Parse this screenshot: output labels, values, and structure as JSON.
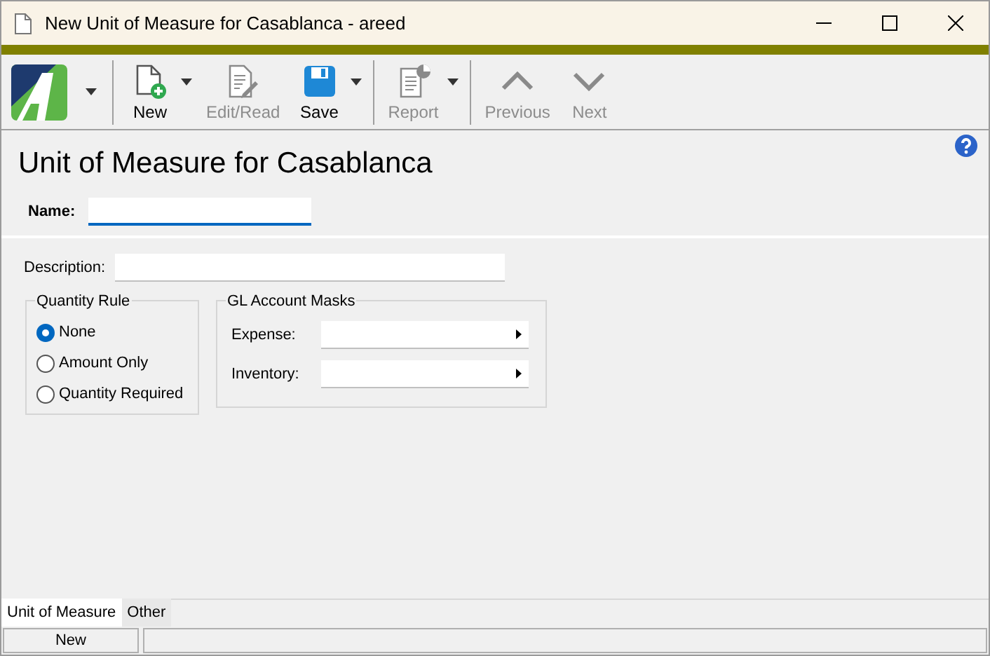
{
  "window": {
    "title": "New Unit of Measure for Casablanca - areed"
  },
  "toolbar": [
    {
      "kind": "logo",
      "dropdown": true
    },
    {
      "kind": "new",
      "label": "New",
      "disabled": false,
      "dropdown": true
    },
    {
      "kind": "edit",
      "label": "Edit/Read",
      "disabled": true,
      "dropdown": false
    },
    {
      "kind": "save",
      "label": "Save",
      "disabled": false,
      "dropdown": true
    },
    {
      "kind": "report",
      "label": "Report",
      "disabled": true,
      "dropdown": true
    },
    {
      "kind": "previous",
      "label": "Previous",
      "disabled": true,
      "dropdown": false
    },
    {
      "kind": "next",
      "label": "Next",
      "disabled": true,
      "dropdown": false
    }
  ],
  "heading": "Unit of Measure for Casablanca",
  "name_field": {
    "label": "Name:"
  },
  "description_field": {
    "label": "Description:"
  },
  "quantity_rule": {
    "title": "Quantity Rule",
    "options": [
      {
        "label": "None",
        "selected": true
      },
      {
        "label": "Amount Only",
        "selected": false
      },
      {
        "label": "Quantity Required",
        "selected": false
      }
    ]
  },
  "gl_account_masks": {
    "title": "GL Account Masks",
    "fields": [
      {
        "label": "Expense:"
      },
      {
        "label": "Inventory:"
      }
    ]
  },
  "tabs": [
    {
      "label": "Unit of Measure",
      "selected": true
    },
    {
      "label": "Other",
      "selected": false
    }
  ],
  "status_bar": {
    "mode": "New"
  }
}
